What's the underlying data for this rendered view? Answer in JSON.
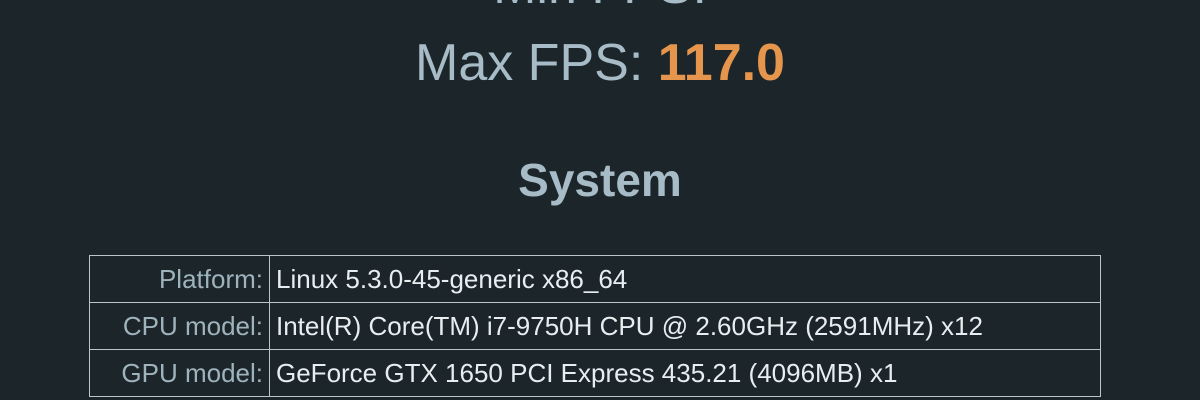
{
  "results": {
    "clipped_label": "Min FPS:",
    "clipped_value": "",
    "max_fps_label": "Max FPS:",
    "max_fps_value": "117.0"
  },
  "system": {
    "title": "System",
    "rows": [
      {
        "label": "Platform:",
        "value": "Linux 5.3.0-45-generic x86_64"
      },
      {
        "label": "CPU model:",
        "value": "Intel(R) Core(TM) i7-9750H CPU @ 2.60GHz (2591MHz) x12"
      },
      {
        "label": "GPU model:",
        "value": "GeForce GTX 1650 PCI Express 435.21 (4096MB) x1"
      }
    ]
  },
  "colors": {
    "background": "#1b252a",
    "label_text": "#a7bcc6",
    "accent_value": "#e5954c",
    "table_border": "#b9c6cc",
    "value_text": "#e8eef0"
  }
}
